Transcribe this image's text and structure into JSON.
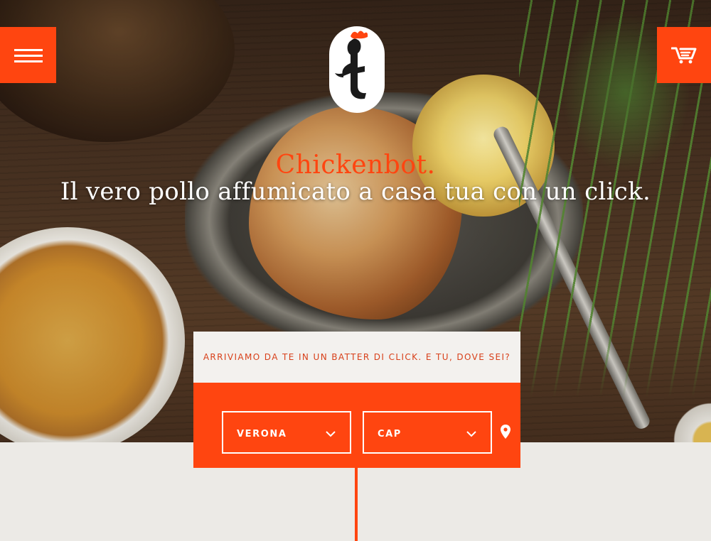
{
  "header": {
    "menu_icon": "hamburger-menu-icon",
    "cart_icon": "shopping-cart-icon",
    "logo_icon": "chicken-logo-icon"
  },
  "hero": {
    "brand": "Chickenbot.",
    "tagline": "Il vero pollo affumicato a casa tua con un click."
  },
  "location": {
    "prompt": "ARRIVIAMO DA TE IN UN BATTER DI CLICK. E TU, DOVE SEI?",
    "city_value": "VERONA",
    "cap_value": "CAP",
    "locate_icon": "map-pin-icon"
  },
  "colors": {
    "accent": "#ff4510",
    "panel": "#f3f1ee",
    "page_bg": "#eceae6"
  }
}
